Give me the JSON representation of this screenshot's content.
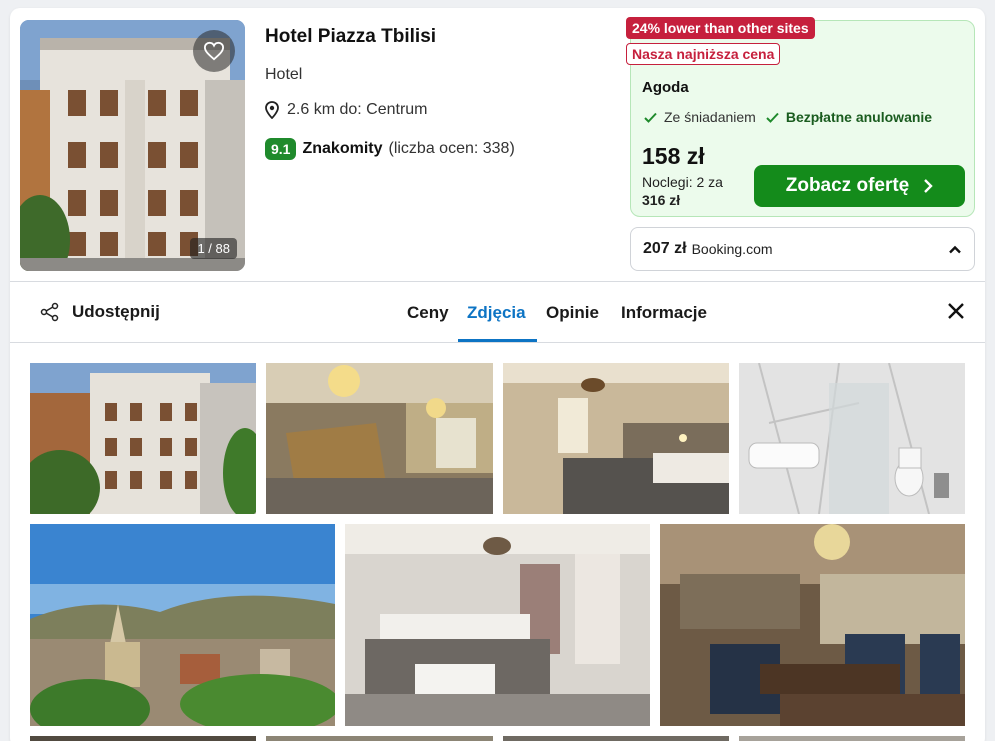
{
  "hotel": {
    "name": "Hotel Piazza Tbilisi",
    "type": "Hotel",
    "distance": "2.6 km do: Centrum",
    "score": "9.1",
    "rating_label": "Znakomity",
    "rating_count": "(liczba ocen: 338)",
    "photo_counter": "1 / 88"
  },
  "deal": {
    "badge_lower": "24% lower than other sites",
    "badge_best": "Nasza najniższa cena",
    "site": "Agoda",
    "feature_1": "Ze śniadaniem",
    "feature_2": "Bezpłatne anulowanie",
    "price": "158 zł",
    "nights_text": "Noclegi: 2 za",
    "total": "316 zł",
    "cta_label": "Zobacz ofertę"
  },
  "alt_offer": {
    "price": "207 zł",
    "site": "Booking.com"
  },
  "tabs": {
    "share_label": "Udostępnij",
    "items": [
      "Ceny",
      "Zdjęcia",
      "Opinie",
      "Informacje"
    ],
    "active": "Zdjęcia"
  },
  "colors": {
    "accent_blue": "#0d74c4",
    "cta_green": "#148b1b",
    "score_green": "#1f8a2c",
    "badge_red": "#c6203d",
    "offer_bg": "#ecfbec"
  },
  "icons": [
    "heart-icon",
    "location-pin-icon",
    "check-icon",
    "chevron-right-icon",
    "chevron-up-icon",
    "share-icon",
    "close-icon"
  ]
}
